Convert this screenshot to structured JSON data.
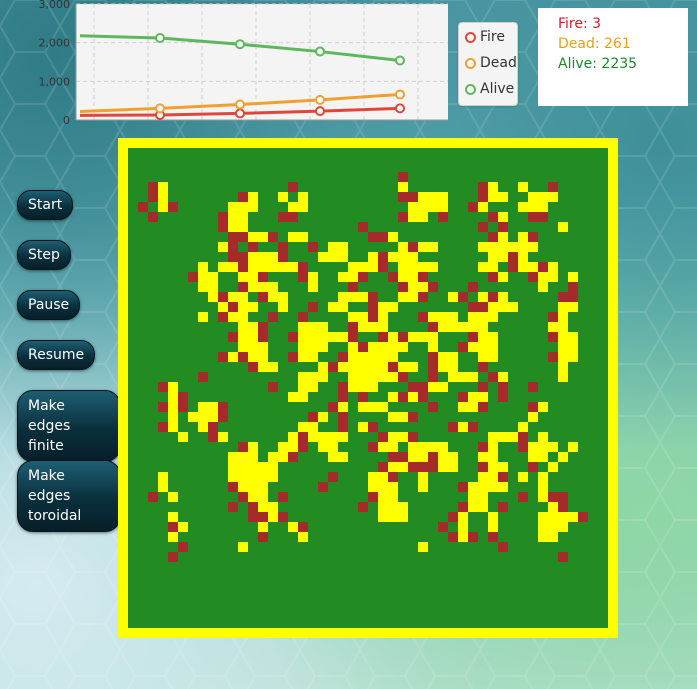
{
  "chart_data": {
    "type": "line",
    "x": [
      0,
      1,
      2,
      3,
      4
    ],
    "series": [
      {
        "name": "Fire",
        "color": "#e0473a",
        "values": [
          120,
          130,
          170,
          230,
          300
        ]
      },
      {
        "name": "Dead",
        "color": "#f0a030",
        "values": [
          220,
          300,
          400,
          520,
          661
        ]
      },
      {
        "name": "Alive",
        "color": "#5cb85c",
        "values": [
          2180,
          2120,
          1960,
          1770,
          1540
        ]
      }
    ],
    "ylim": [
      0,
      3000
    ],
    "yticks": [
      "0",
      "1,000",
      "2,000",
      "3,000"
    ],
    "grid": true,
    "legend": "right"
  },
  "status": {
    "fire": "Fire: 3",
    "dead": "Dead: 261",
    "alive": "Alive: 2235",
    "fire_color": "#d0202a",
    "dead_color": "#e6a020",
    "alive_color": "#1a8a2a"
  },
  "controls": {
    "start": "Start",
    "step": "Step",
    "pause": "Pause",
    "resume": "Resume",
    "finite_line1": "Make edges",
    "finite_line2": "finite",
    "toroidal_line1": "Make edges",
    "toroidal_line2": "toroidal"
  },
  "grid": {
    "colors": {
      "empty": "#228b22",
      "tree": "#ffff00",
      "fire": "#a52a2a",
      "border": "#ffff00"
    },
    "rows": [
      "..................................................",
      "..................................................",
      "...........................f...................",
      "..fY............f..........Y.......fY..Y..f.......",
      "..fY.......fY..Y.Y.........ffYYY...fYY..YYY.......",
      ".f.Yf.....YYY...YY..........YYYY..fY...YYY.......",
      "..f......fYY...ff..........fYY.f....fY..ff........",
      ".........fYY...........f...........f.f.....Y.....",
      "..........ffYYf.YY......ffY.........fY.Yf.........",
      ".........Yf.f..f..f.YY.....YfYY....YYYYYY.........",
      "..........ffYYYf...YYY..YfYYY.......YYfY.........",
      ".......Y.YYfYYYYYf....YYYf.YYYY....YY.fYYfY......",
      "......fYY..YYf...fY..YYf..fYYf......fY..fYY.Y.....",
      ".......YY..fYYY...Y...f....fYYf...f......Y..f.....",
      "........YfYY.fYY.....YYYf..YYf..Yf.YfY.....ff.....",
      ".........YfYY..Y..f.YY..fYY.......ffYYY....YY.....",
      ".......Y.fYY..f..f....YYfY...fYYY.YYY.....fY.....",
      "...........YYf...YYY..fYYY....fYYYYY......YY.....",
      "..........fYYf..fYYYYYf..fYfYYY...fYY.....fYY.....",
      "...........YYY...YYY..YfYYYY..Y..fYYY......YY.....",
      ".........fYfYY..fYY..fYYYYY...fYY..YY.....fYY.....",
      "............fYY....YfYYYYYfYY.fYY..f.......Y.....",
      ".......f.........YYY..YYYYYf..f.YYY.fY.....Y......",
      "...fY.........f..YY..fYYY...ffYY...f.f..f........",
      "....Yf..........YY...f.f..YfYf...fYY.f..........",
      "...fYf.YYf..........fY.YYY....f..YYf....fY.......",
      "....Y.YYYf........fY.f....YYf...........Y........",
      "...fY..Yf........YY..f.Yf.......fYf....Y........",
      ".....Y..fY......YfYYYY...fYYf.......YYYf.Y........",
      "...........fY..YYf.YY...fYY.YYYY...fY..fYYY.Y.....",
      "..........YYY.YYf...YY....ffYYfYY..YY...YY.Y.....",
      "..........YYYYY..........fYYfffYY..fYY..f.Y......",
      "...Y......YYYYY.....f...YYf..Y.....YYf.Y.Y......",
      "...Y......fYYY.....f....YYY..Y...fYYYY...Y.......",
      "..f.Y......fYY.f........fYY.......YY...f.Yff.....",
      "..........f.fYY........f.YYY.....fYY.f....Yf....",
      "....Y.......ffYf.........YYY....fY..Y....YYYYf....",
      "....fY.......Y..Yf.............f.Y..Y....YYY.....",
      "....Y........f...Y..............fYf.f....YY......",
      ".....f.....Y.................Y.......f...........",
      "....f......................................f......",
      "..................................................",
      ".................................................."
    ]
  }
}
